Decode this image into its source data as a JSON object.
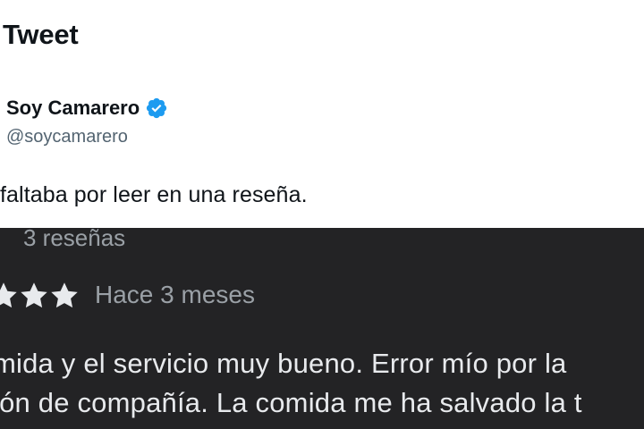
{
  "header": {
    "title": "Tweet"
  },
  "author": {
    "display_name": "Soy Camarero",
    "handle": "@soycamarero",
    "verified_icon": "verified-badge-icon",
    "verified_color": "#1d9bf0"
  },
  "tweet": {
    "text": "faltaba por leer en una reseña."
  },
  "review": {
    "count_text": "3 reseñas",
    "stars_visible": 3,
    "star_icon": "star-icon",
    "date": "Hace 3 meses",
    "lines": [
      "mida y el servicio muy bueno. Error mío por la",
      "ión de compañía. La comida me ha salvado la t"
    ]
  }
}
